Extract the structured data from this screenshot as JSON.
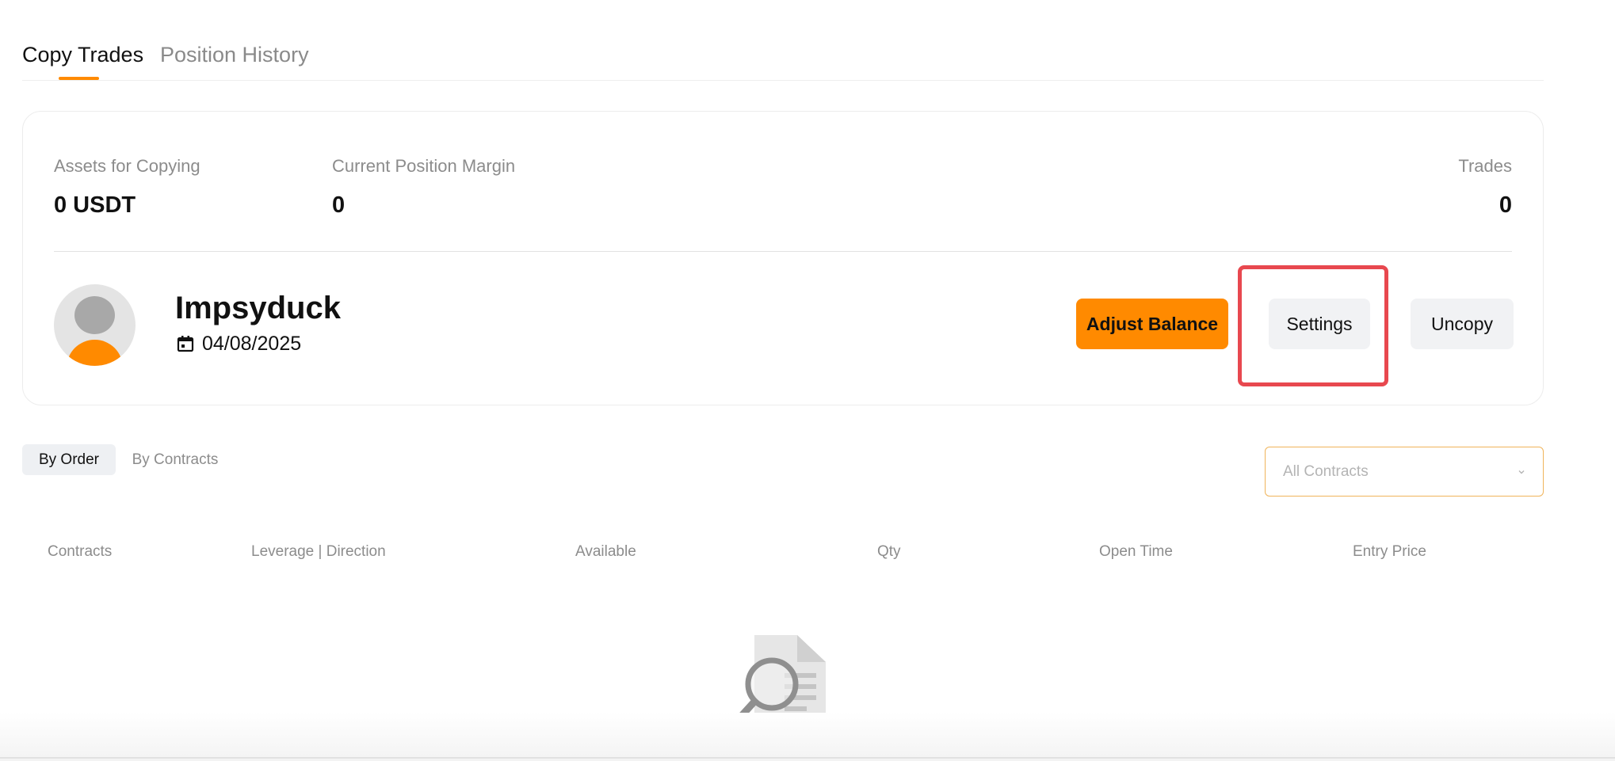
{
  "tabs": {
    "copy_trades": "Copy Trades",
    "position_history": "Position History"
  },
  "stats": {
    "assets_label": "Assets for Copying",
    "assets_value": "0 USDT",
    "margin_label": "Current Position Margin",
    "margin_value": "0",
    "trades_label": "Trades",
    "trades_value": "0"
  },
  "profile": {
    "name": "Impsyduck",
    "date": "04/08/2025"
  },
  "buttons": {
    "adjust_balance": "Adjust Balance",
    "settings": "Settings",
    "uncopy": "Uncopy"
  },
  "filters": {
    "by_order": "By Order",
    "by_contracts": "By Contracts",
    "contracts_select": "All Contracts"
  },
  "table": {
    "columns": [
      "Contracts",
      "Leverage | Direction",
      "Available",
      "Qty",
      "Open Time",
      "Entry Price"
    ]
  },
  "colors": {
    "accent": "#ff8a00",
    "highlight": "#e8484f"
  },
  "icons": {
    "calendar": "calendar-icon",
    "chevron": "chevron-down-icon",
    "empty": "empty-search-icon"
  }
}
